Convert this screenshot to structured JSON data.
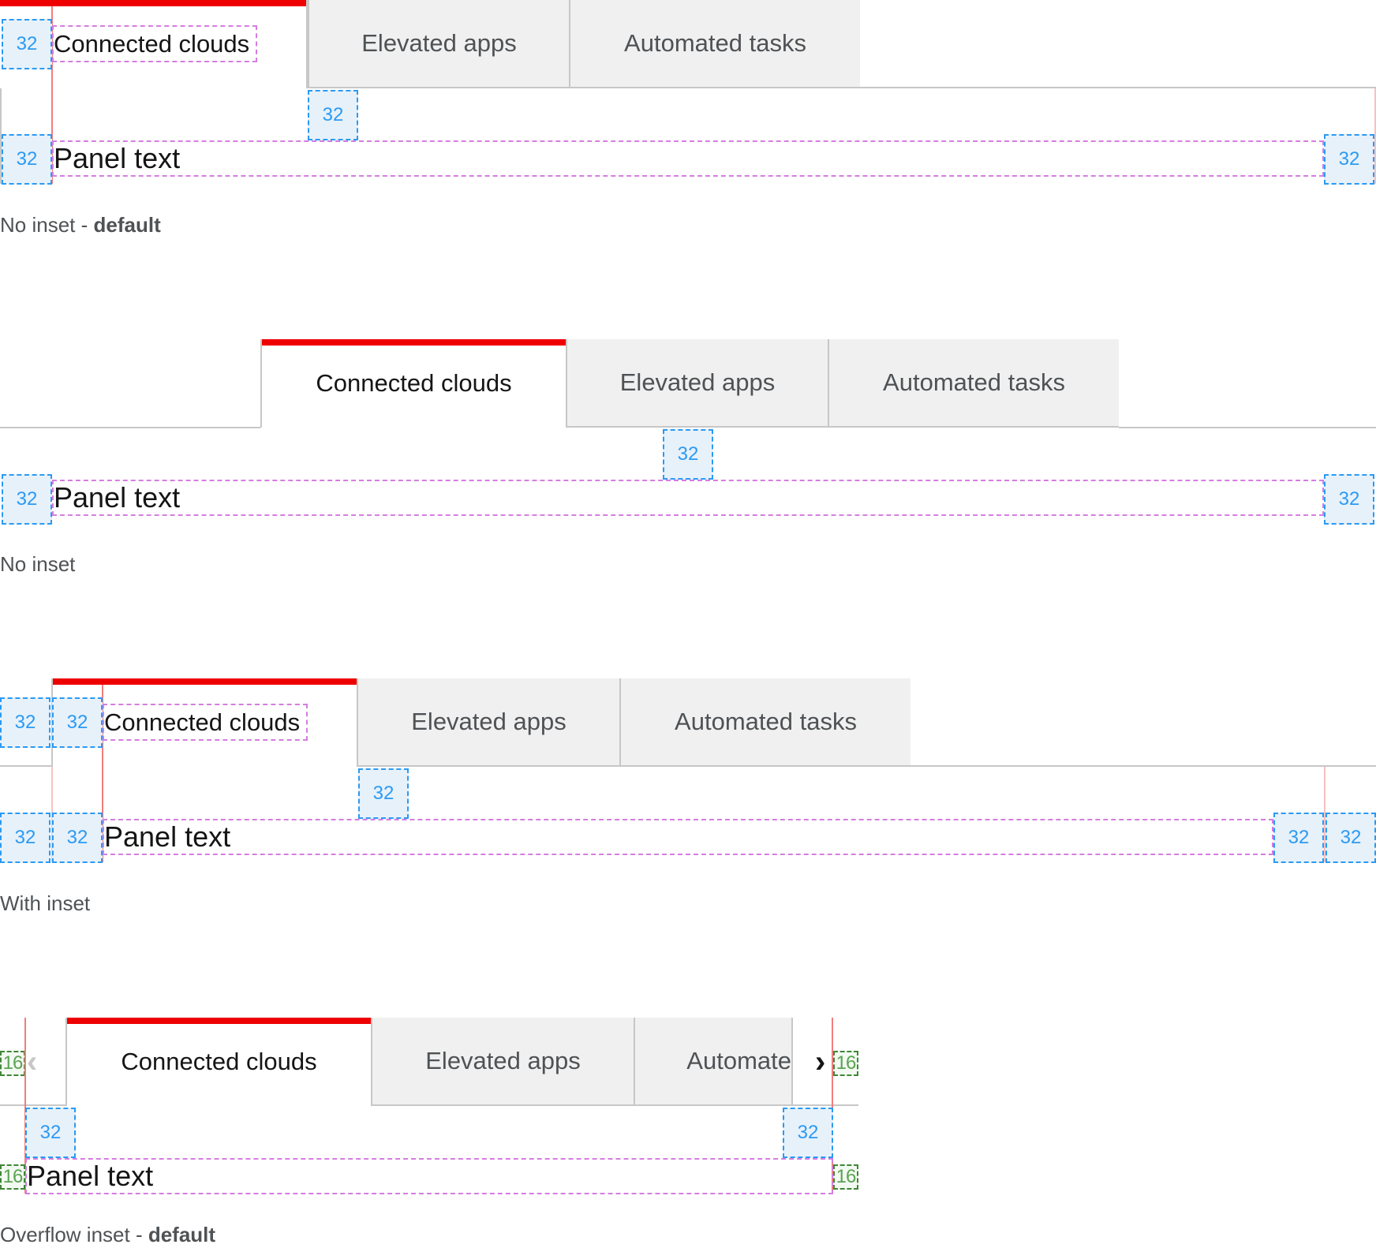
{
  "tabs": [
    "Connected clouds",
    "Elevated apps",
    "Automated tasks"
  ],
  "overflow_tabs": [
    "Connected clouds",
    "Elevated apps",
    "Automate"
  ],
  "panel_text": "Panel text",
  "spacers": {
    "large": "32",
    "small": "16"
  },
  "colors": {
    "active_accent": "#ee0000",
    "spacer_32": "#2b9af3",
    "spacer_16": "#3e8635",
    "text_box": "#d57de0"
  },
  "sections": [
    {
      "caption": "No inset - ",
      "caption_bold": "default"
    },
    {
      "caption": "No inset",
      "caption_bold": ""
    },
    {
      "caption": "With inset",
      "caption_bold": ""
    },
    {
      "caption": "Overflow inset - ",
      "caption_bold": "default"
    }
  ],
  "icons": {
    "scroll_left": "chevron-left-icon",
    "scroll_right": "chevron-right-icon"
  }
}
